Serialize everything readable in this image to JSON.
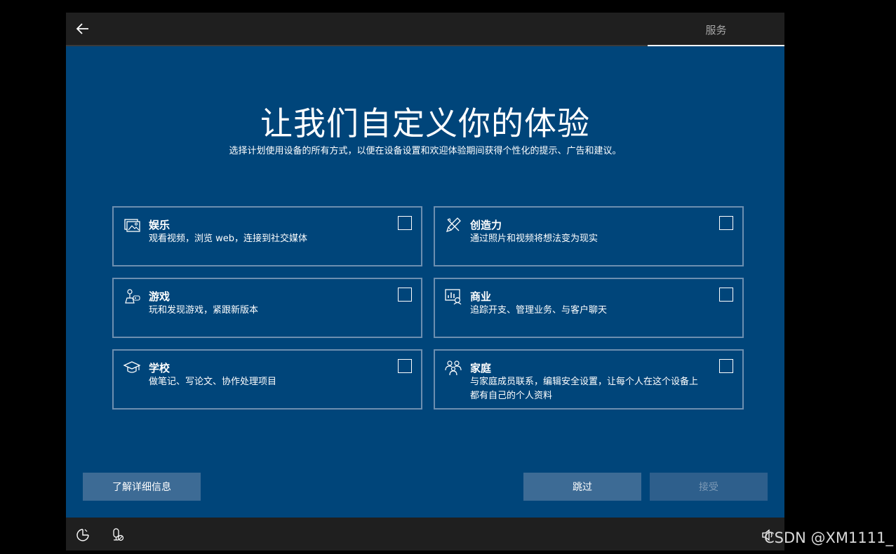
{
  "topbar": {
    "back_icon": "arrow-left-icon",
    "tab_label": "服务"
  },
  "main": {
    "title": "让我们自定义你的体验",
    "subtitle": "选择计划使用设备的所有方式，以便在设备设置和欢迎体验期间获得个性化的提示、广告和建议。"
  },
  "cards": [
    {
      "icon": "photos-icon",
      "label": "娱乐",
      "desc": "观看视频，浏览 web，连接到社交媒体",
      "checked": false
    },
    {
      "icon": "pen-ruler-icon",
      "label": "创造力",
      "desc": "通过照片和视频将想法变为现实",
      "checked": false
    },
    {
      "icon": "game-controller-icon",
      "label": "游戏",
      "desc": "玩和发现游戏，紧跟新版本",
      "checked": false
    },
    {
      "icon": "business-chart-icon",
      "label": "商业",
      "desc": "追踪开支、管理业务、与客户聊天",
      "checked": false
    },
    {
      "icon": "graduation-cap-icon",
      "label": "学校",
      "desc": "做笔记、写论文、协作处理项目",
      "checked": false
    },
    {
      "icon": "family-icon",
      "label": "家庭",
      "desc": "与家庭成员联系，编辑安全设置，让每个人在这个设备上都有自己的个人资料",
      "checked": false
    }
  ],
  "buttons": {
    "learn_more": "了解详细信息",
    "skip": "跳过",
    "accept": "接受"
  },
  "bottombar": {
    "icons": [
      "accessibility-icon",
      "microphone-icon",
      "volume-icon"
    ]
  },
  "watermark": "CSDN @XM1111_",
  "colors": {
    "background": "#00457a",
    "topbar": "#1f1f1f",
    "button": "#3d6b95",
    "card_border": "#6d8fb0"
  }
}
